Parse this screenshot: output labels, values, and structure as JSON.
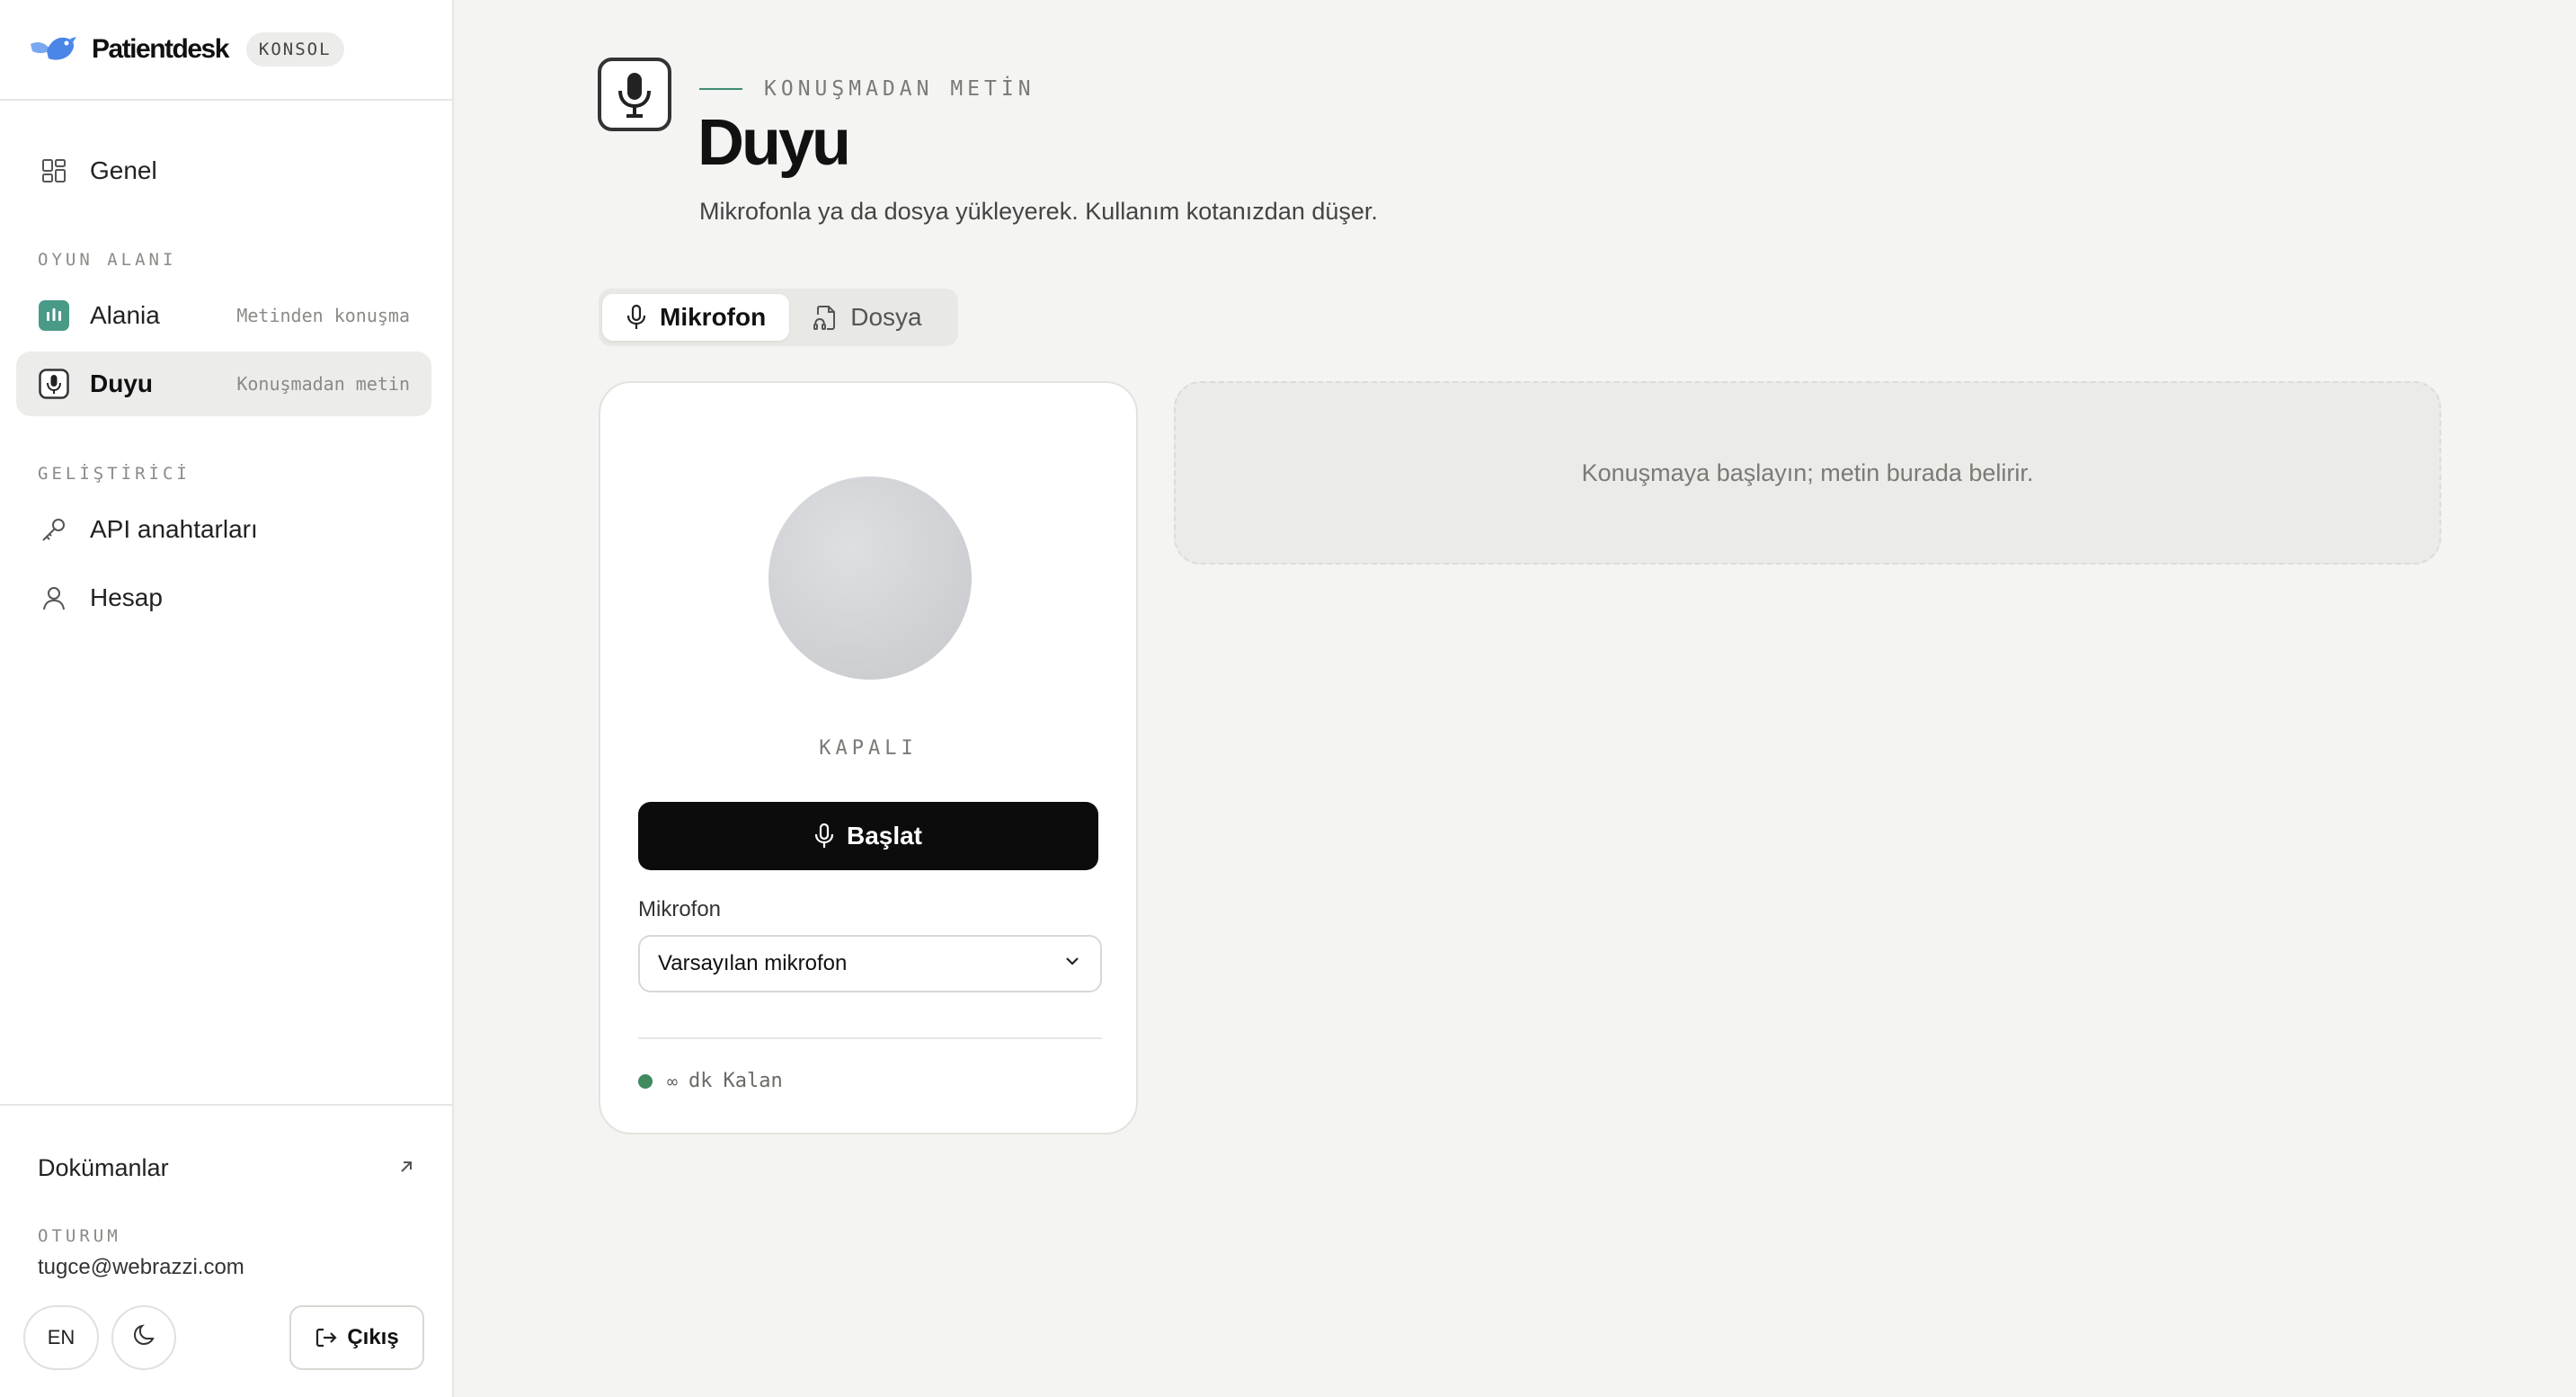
{
  "brand": {
    "name": "Patientdesk",
    "badge": "KONSOL"
  },
  "sidebar": {
    "general": {
      "label": "Genel"
    },
    "sections": [
      {
        "label": "OYUN ALANI"
      },
      {
        "label": "GELİŞTİRİCİ"
      }
    ],
    "items": [
      {
        "label": "Alania",
        "hint": "Metinden konuşma"
      },
      {
        "label": "Duyu",
        "hint": "Konuşmadan metin",
        "active": true
      },
      {
        "label": "API anahtarları"
      },
      {
        "label": "Hesap"
      }
    ],
    "docs": {
      "label": "Dokümanlar"
    },
    "session": {
      "label": "OTURUM",
      "email": "tugce@webrazzi.com"
    },
    "lang_button": "EN",
    "logout_label": "Çıkış"
  },
  "header": {
    "eyebrow": "KONUŞMADAN METİN",
    "title": "Duyu",
    "subtitle": "Mikrofonla ya da dosya yükleyerek. Kullanım kotanızdan düşer."
  },
  "tabs": [
    {
      "label": "Mikrofon",
      "active": true
    },
    {
      "label": "Dosya",
      "active": false
    }
  ],
  "mic_card": {
    "status": "KAPALI",
    "start_label": "Başlat",
    "field_label": "Mikrofon",
    "selected_device": "Varsayılan mikrofon",
    "quota": {
      "value": "∞",
      "unit": "dk",
      "label": "Kalan"
    }
  },
  "transcript": {
    "placeholder": "Konuşmaya başlayın; metin burada belirir."
  },
  "colors": {
    "accent": "#3f8a73",
    "app_accent": "#4a9a88",
    "primary_button": "#0c0c0c",
    "status_dot": "#3f8a5f"
  }
}
